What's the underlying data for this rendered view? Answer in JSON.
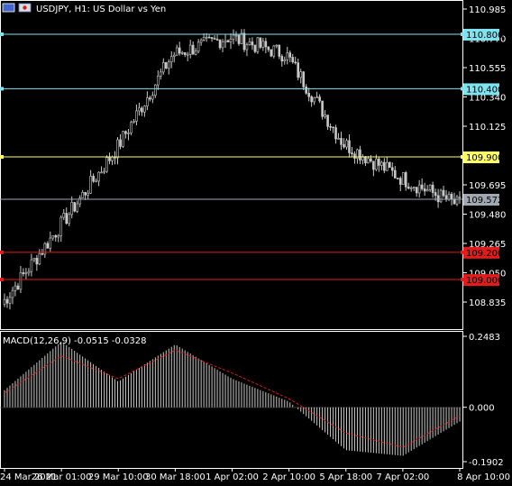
{
  "header": {
    "title": "USDJPY, H1:  US Dollar vs Yen"
  },
  "price_axis": {
    "ticks": [
      "110.985",
      "110.770",
      "110.555",
      "110.340",
      "110.125",
      "109.695",
      "109.480",
      "109.265",
      "109.050",
      "108.835"
    ],
    "current_price": "109.572"
  },
  "level_lines": [
    {
      "label": "110.800",
      "price": 110.8,
      "color": "#7fe3f0"
    },
    {
      "label": "110.400",
      "price": 110.4,
      "color": "#7fe3f0"
    },
    {
      "label": "109.900",
      "price": 109.9,
      "color": "#ffff66"
    },
    {
      "label": "109.200",
      "price": 109.2,
      "color": "#e21b1b"
    },
    {
      "label": "109.000",
      "price": 109.0,
      "color": "#e21b1b"
    }
  ],
  "time_axis": {
    "labels": [
      "24 Mar 2021",
      "26 Mar 01:00",
      "29 Mar 10:00",
      "30 Mar 18:00",
      "1 Apr 02:00",
      "2 Apr 10:00",
      "5 Apr 18:00",
      "7 Apr 02:00",
      "8 Apr 10:00"
    ]
  },
  "macd": {
    "label": "MACD(12,26,9) -0.0515 -0.0328",
    "ticks": [
      "0.2483",
      "0.000",
      "-0.1902"
    ]
  },
  "colors": {
    "background": "#000000",
    "candle": "#c8c8c8",
    "grid_line": "#ffffff",
    "signal": "#e21b1b",
    "cyan": "#7fe3f0",
    "yellow": "#ffff66",
    "red": "#e21b1b",
    "current": "#a0a8b4"
  },
  "chart_data": [
    {
      "type": "line",
      "name": "price",
      "x": [
        "24 Mar 2021",
        "26 Mar 01:00",
        "29 Mar 10:00",
        "30 Mar 18:00",
        "1 Apr 02:00",
        "2 Apr 10:00",
        "5 Apr 18:00",
        "7 Apr 02:00",
        "8 Apr 10:00"
      ],
      "values": [
        108.82,
        109.38,
        109.95,
        110.65,
        110.78,
        110.65,
        110.0,
        109.75,
        109.55
      ],
      "ylim": [
        108.7,
        111.05
      ]
    },
    {
      "type": "bar",
      "name": "MACD",
      "x": [
        "24 Mar 2021",
        "26 Mar 01:00",
        "29 Mar 10:00",
        "30 Mar 18:00",
        "1 Apr 02:00",
        "2 Apr 10:00",
        "5 Apr 18:00",
        "7 Apr 02:00",
        "8 Apr 10:00"
      ],
      "values": [
        0.06,
        0.23,
        0.09,
        0.22,
        0.1,
        0.02,
        -0.15,
        -0.17,
        -0.05
      ],
      "signal": [
        0.05,
        0.18,
        0.1,
        0.2,
        0.12,
        0.03,
        -0.09,
        -0.14,
        -0.03
      ],
      "ylim": [
        -0.1902,
        0.2483
      ]
    }
  ]
}
